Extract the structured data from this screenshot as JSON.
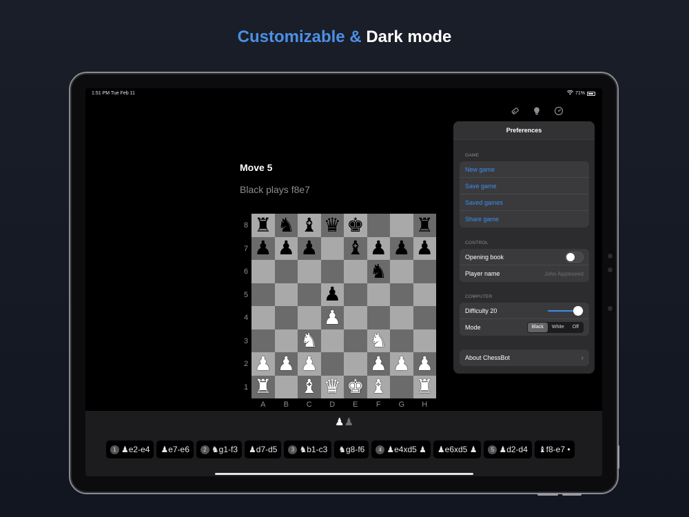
{
  "headline": {
    "accent": "Customizable &",
    "main": "Dark mode"
  },
  "status": {
    "time": "1:51 PM  Tue Feb 11",
    "battery": "71%",
    "wifi_icon": "wifi-icon"
  },
  "toolbar": {
    "icons": [
      "eraser-icon",
      "lightbulb-icon",
      "settings-gauge-icon"
    ]
  },
  "game": {
    "move_title": "Move 5",
    "move_subtitle": "Black plays f8e7"
  },
  "board": {
    "ranks": [
      "8",
      "7",
      "6",
      "5",
      "4",
      "3",
      "2",
      "1"
    ],
    "files": [
      "A",
      "B",
      "C",
      "D",
      "E",
      "F",
      "G",
      "H"
    ],
    "rows": [
      [
        "br",
        "bn",
        "bb",
        "bq",
        "bk",
        "",
        "",
        "br"
      ],
      [
        "bp",
        "bp",
        "bp",
        "",
        "bb",
        "bp",
        "bp",
        "bp"
      ],
      [
        "",
        "",
        "",
        "",
        "",
        "bn",
        "",
        ""
      ],
      [
        "",
        "",
        "",
        "bp",
        "",
        "",
        "",
        ""
      ],
      [
        "",
        "",
        "",
        "wp",
        "",
        "",
        "",
        ""
      ],
      [
        "",
        "",
        "wn",
        "",
        "",
        "wn",
        "",
        ""
      ],
      [
        "wp",
        "wp",
        "wp",
        "",
        "",
        "wp",
        "wp",
        "wp"
      ],
      [
        "wr",
        "",
        "wb",
        "wq",
        "wk",
        "wb",
        "",
        "wr"
      ]
    ]
  },
  "turn_indicator": {
    "white": "♟",
    "black": "♟"
  },
  "moves": [
    {
      "num": "1",
      "text": "♟e2-e4"
    },
    {
      "num": "",
      "text": "♟e7-e6"
    },
    {
      "num": "2",
      "text": "♞g1-f3"
    },
    {
      "num": "",
      "text": "♟d7-d5"
    },
    {
      "num": "3",
      "text": "♞b1-c3"
    },
    {
      "num": "",
      "text": "♞g8-f6"
    },
    {
      "num": "4",
      "text": "♟e4xd5 ♟"
    },
    {
      "num": "",
      "text": "♟e6xd5 ♟"
    },
    {
      "num": "5",
      "text": "♟d2-d4"
    },
    {
      "num": "",
      "text": "♝f8-e7 •"
    }
  ],
  "preferences": {
    "title": "Preferences",
    "game_label": "GAME",
    "game_items": [
      "New game",
      "Save game",
      "Saved games",
      "Share game"
    ],
    "control_label": "CONTROL",
    "opening_book": "Opening book",
    "opening_book_on": false,
    "player_name_label": "Player name",
    "player_name_placeholder": "John Appleseed",
    "computer_label": "COMPUTER",
    "difficulty": "Difficulty 20",
    "difficulty_level": 0.85,
    "mode_label": "Mode",
    "mode_options": [
      "Black",
      "White",
      "Off"
    ],
    "mode_selected": "Black",
    "about": "About ChessBot"
  },
  "colors": {
    "accent": "#4d8fe6",
    "link": "#3a8ef0",
    "light_square": "#a9a9a9",
    "dark_square": "#6b6b6b"
  }
}
